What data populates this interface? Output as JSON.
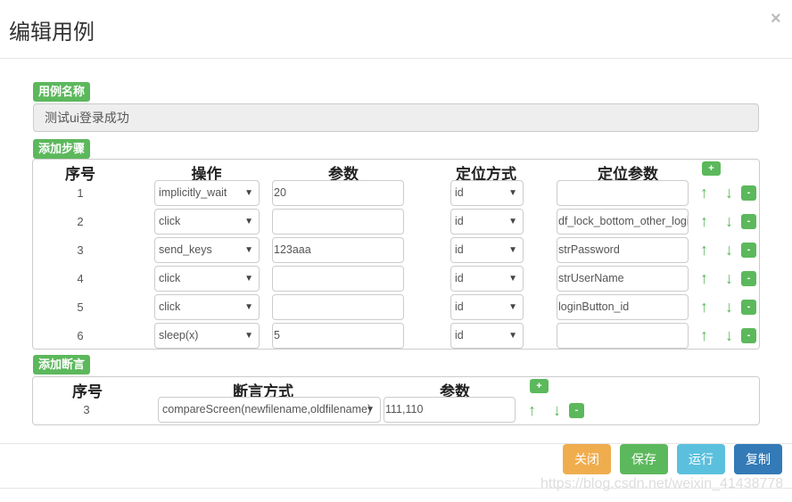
{
  "dialog": {
    "title": "编辑用例",
    "close": "×"
  },
  "case_name": {
    "label": "用例名称",
    "value": "测试ui登录成功"
  },
  "steps": {
    "label": "添加步骤",
    "headers": [
      "序号",
      "操作",
      "参数",
      "定位方式",
      "定位参数"
    ],
    "add": "+",
    "remove": "-",
    "up": "🡑",
    "down": "🡓",
    "rows": [
      {
        "seq": "1",
        "op": "implicitly_wait",
        "param": "20",
        "locate": "id",
        "locate_param": ""
      },
      {
        "seq": "2",
        "op": "click",
        "param": "",
        "locate": "id",
        "locate_param": "df_lock_bottom_other_login"
      },
      {
        "seq": "3",
        "op": "send_keys",
        "param": "123aaa",
        "locate": "id",
        "locate_param": "strPassword"
      },
      {
        "seq": "4",
        "op": "click",
        "param": "",
        "locate": "id",
        "locate_param": "strUserName"
      },
      {
        "seq": "5",
        "op": "click",
        "param": "",
        "locate": "id",
        "locate_param": "loginButton_id"
      },
      {
        "seq": "6",
        "op": "sleep(x)",
        "param": "5",
        "locate": "id",
        "locate_param": ""
      }
    ]
  },
  "asserts": {
    "label": "添加断言",
    "headers": [
      "序号",
      "断言方式",
      "参数"
    ],
    "add": "+",
    "remove": "-",
    "rows": [
      {
        "seq": "3",
        "method": "compareScreen(newfilename,oldfilename)",
        "param": "111,110"
      }
    ]
  },
  "footer": {
    "close": "关闭",
    "save": "保存",
    "run": "运行",
    "copy": "复制",
    "close_color": "#f0ad4e",
    "save_color": "#5cb85c",
    "run_color": "#5bc0de",
    "copy_color": "#337ab7"
  },
  "watermark": "https://blog.csdn.net/weixin_41438778"
}
